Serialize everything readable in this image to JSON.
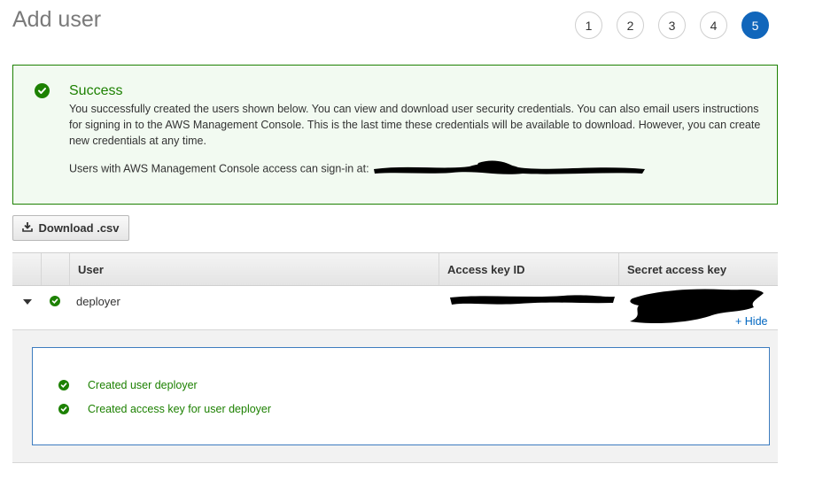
{
  "page": {
    "title": "Add user"
  },
  "steps": [
    {
      "label": "1",
      "active": false
    },
    {
      "label": "2",
      "active": false
    },
    {
      "label": "3",
      "active": false
    },
    {
      "label": "4",
      "active": false
    },
    {
      "label": "5",
      "active": true
    }
  ],
  "success": {
    "title": "Success",
    "message": "You successfully created the users shown below. You can view and download user security credentials. You can also email users instructions for signing in to the AWS Management Console. This is the last time these credentials will be available to download. However, you can create new credentials at any time.",
    "signin_label": "Users with AWS Management Console access can sign-in at:"
  },
  "toolbar": {
    "download_label": "Download .csv"
  },
  "table": {
    "columns": [
      "",
      "",
      "User",
      "Access key ID",
      "Secret access key"
    ],
    "rows": [
      {
        "user": "deployer",
        "hide_label": "Hide"
      }
    ]
  },
  "details": {
    "items": [
      {
        "text": "Created user deployer"
      },
      {
        "text": "Created access key for user deployer"
      }
    ]
  },
  "colors": {
    "success": "#1d8102",
    "primary": "#1166bb",
    "link": "#0066c0"
  }
}
